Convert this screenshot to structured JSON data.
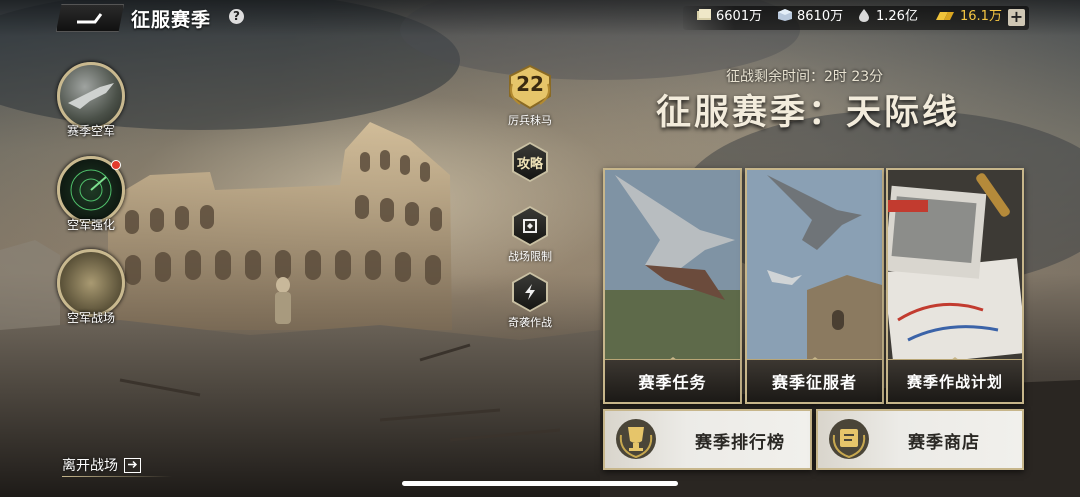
{
  "header": {
    "title": "征服赛季",
    "help_icon": "?"
  },
  "resources": [
    {
      "icon": "cash-icon",
      "value": "6601万"
    },
    {
      "icon": "cube-icon",
      "value": "8610万"
    },
    {
      "icon": "oil-icon",
      "value": "1.26亿"
    },
    {
      "icon": "gold-icon",
      "value": "16.1万",
      "color": "#f4c542"
    }
  ],
  "left_menu": [
    {
      "id": "air-force",
      "label": "赛季空军"
    },
    {
      "id": "air-upgrade",
      "label": "空军强化",
      "notification": true
    },
    {
      "id": "air-battlefield",
      "label": "空军战场"
    }
  ],
  "middle_menu": {
    "level": {
      "value": "22",
      "label": "厉兵秣马"
    },
    "items": [
      {
        "id": "strategy",
        "icon_text": "攻略",
        "label": ""
      },
      {
        "id": "battle-limit",
        "label": "战场限制"
      },
      {
        "id": "raid",
        "label": "奇袭作战"
      }
    ]
  },
  "season": {
    "timer_label": "征战剩余时间：",
    "timer_value": "2时 23分",
    "title": "征服赛季：天际线"
  },
  "cards": [
    {
      "id": "season-tasks",
      "label": "赛季任务"
    },
    {
      "id": "season-conqueror",
      "label": "赛季征服者"
    },
    {
      "id": "season-plan",
      "label": "赛季作战计划"
    }
  ],
  "wide_buttons": [
    {
      "id": "season-ranking",
      "label": "赛季排行榜"
    },
    {
      "id": "season-shop",
      "label": "赛季商店"
    }
  ],
  "footer": {
    "leave_label": "离开战场"
  },
  "colors": {
    "accent_gold": "#c7b68b",
    "notification": "#e23b2d"
  }
}
